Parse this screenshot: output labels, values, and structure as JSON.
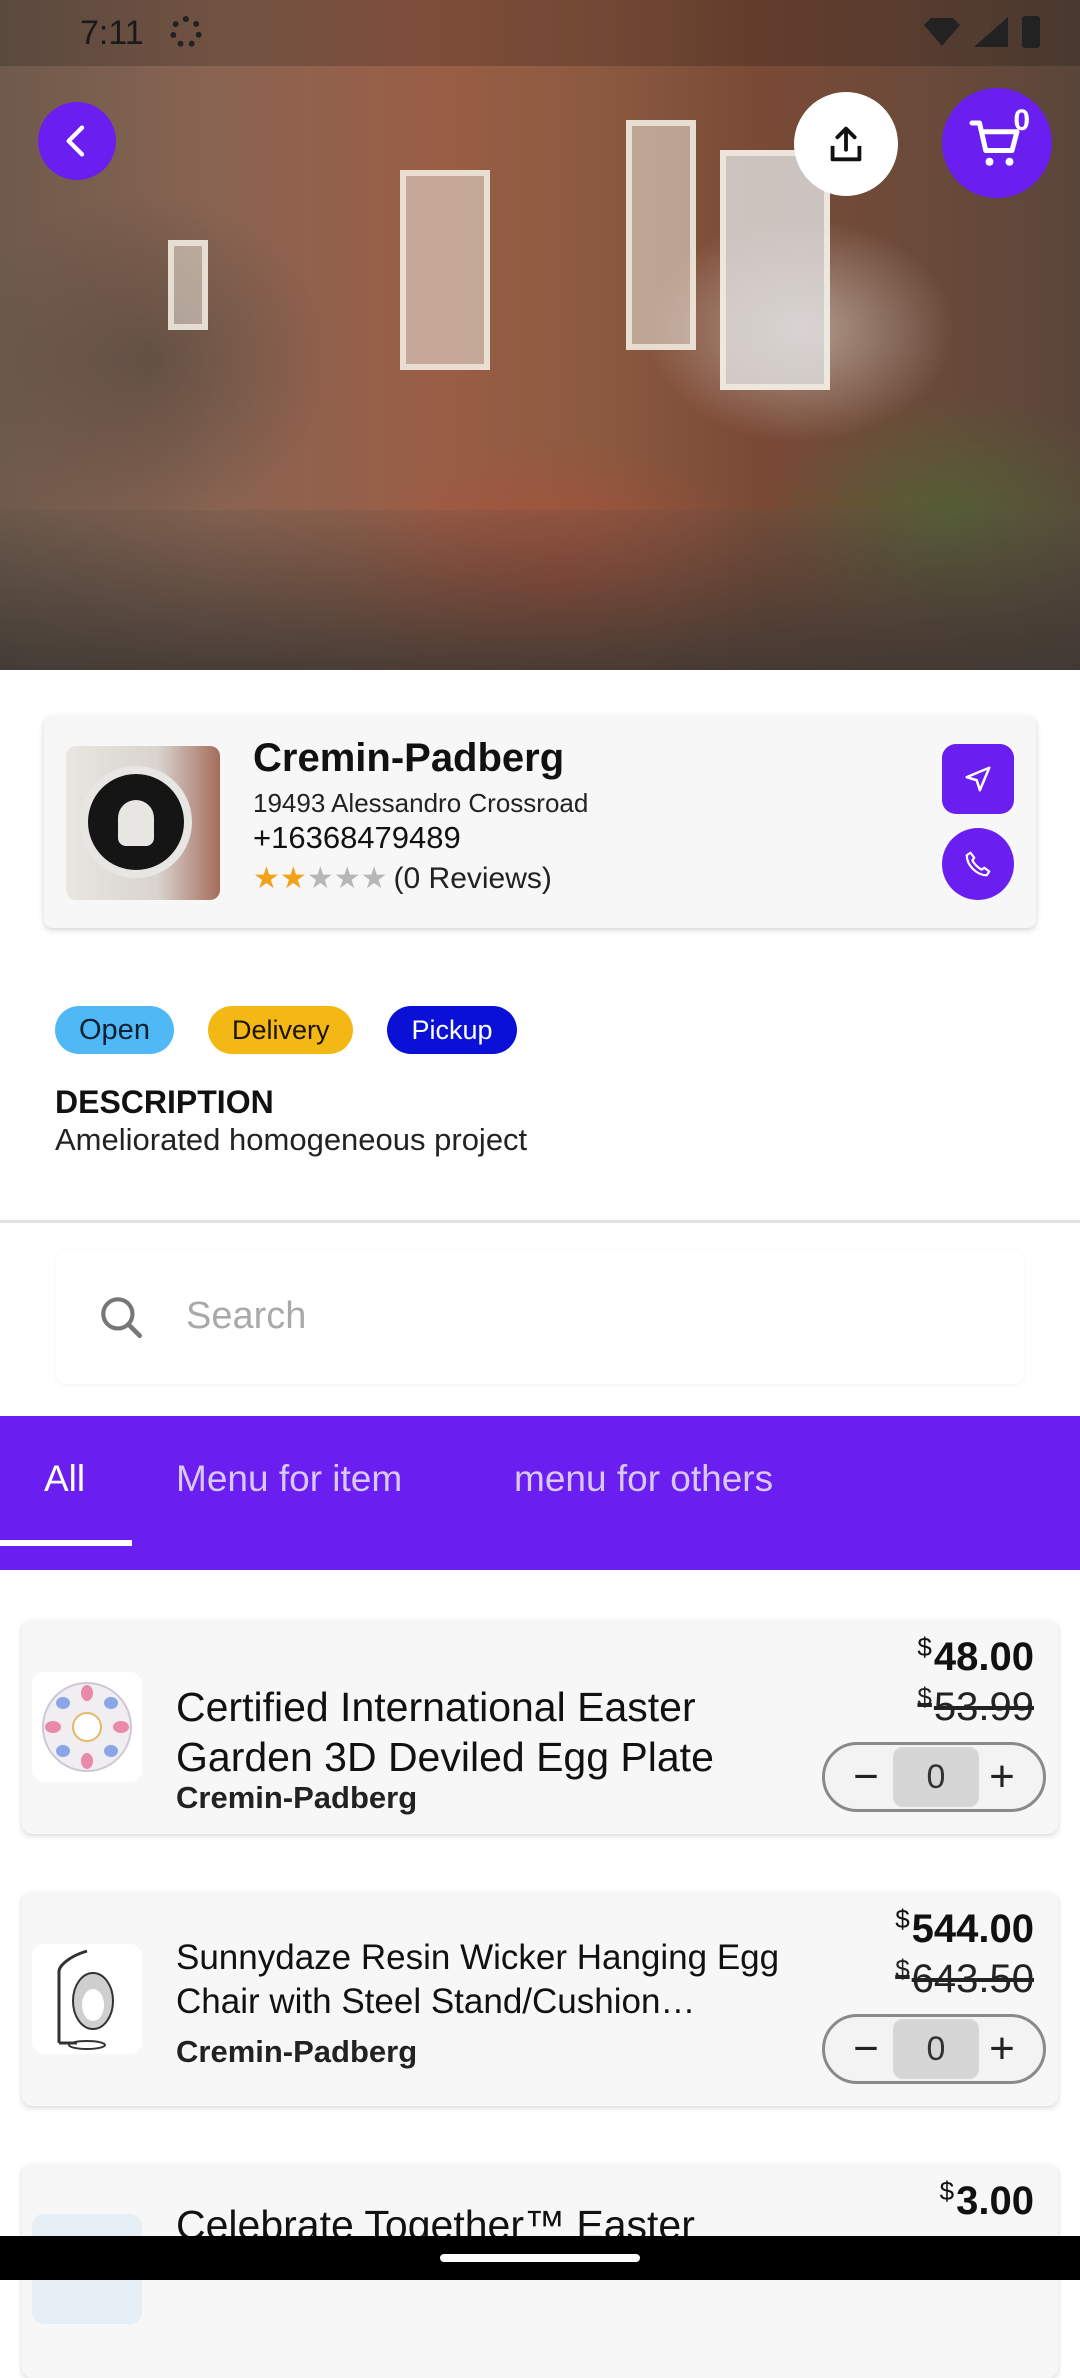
{
  "status_bar": {
    "time": "7:11"
  },
  "hero": {
    "image_desc_icon": "storefront-photo"
  },
  "header": {
    "cart_count": "0"
  },
  "store": {
    "name": "Cremin-Padberg",
    "address": "19493 Alessandro Crossroad",
    "phone": "+16368479489",
    "rating": 2,
    "rating_max": 5,
    "reviews_label": "(0 Reviews)"
  },
  "tags": {
    "open": "Open",
    "delivery": "Delivery",
    "pickup": "Pickup"
  },
  "description": {
    "heading": "DESCRIPTION",
    "text": "Ameliorated homogeneous project"
  },
  "search": {
    "placeholder": "Search"
  },
  "tabs": [
    {
      "label": "All",
      "active": true
    },
    {
      "label": "Menu for item",
      "active": false
    },
    {
      "label": "menu for others",
      "active": false
    }
  ],
  "products": [
    {
      "title": "Certified International Easter Garden 3D Deviled Egg Plate",
      "store": "Cremin-Padberg",
      "currency": "$",
      "price": "48.00",
      "old_price": "53.99",
      "quantity": "0"
    },
    {
      "title": "Sunnydaze Resin Wicker Hanging Egg Chair with Steel Stand/Cushion…",
      "store": "Cremin-Padberg",
      "currency": "$",
      "price": "544.00",
      "old_price": "643.50",
      "quantity": "0"
    },
    {
      "title": "Celebrate Together™ Easter",
      "currency": "$",
      "price": "3.00"
    }
  ],
  "colors": {
    "accent": "#6a1ef0",
    "open": "#4fb8f5",
    "delivery": "#f4b814",
    "pickup": "#0a10d6",
    "star": "#f0a21a"
  }
}
